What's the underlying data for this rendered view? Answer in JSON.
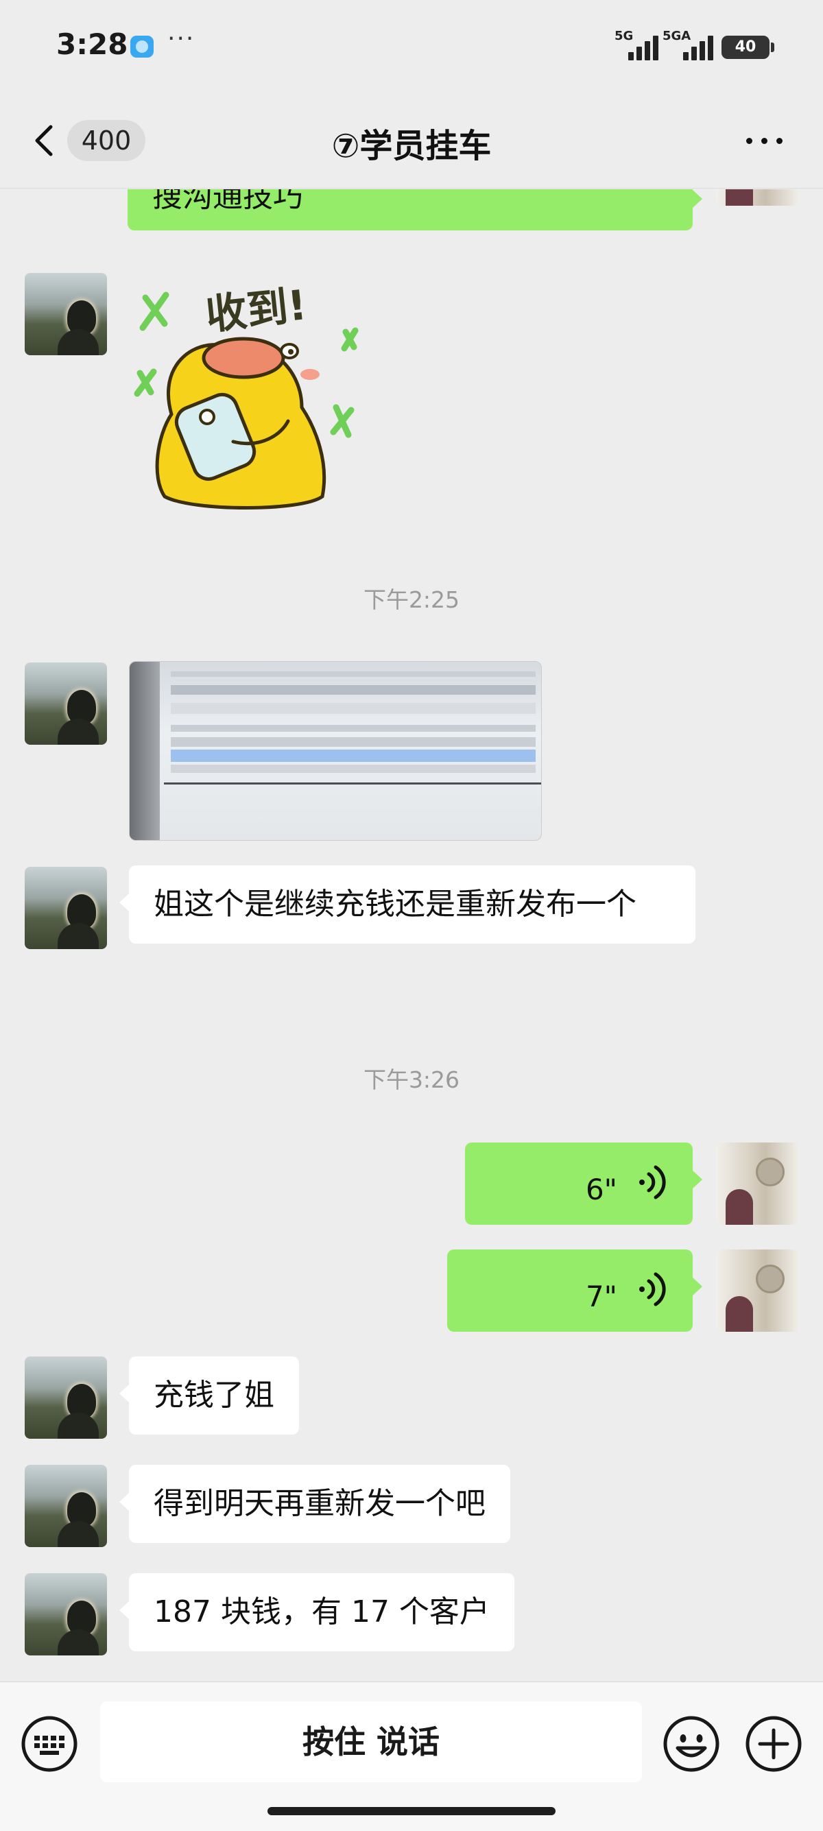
{
  "status_bar": {
    "time": "3:28",
    "more": "···",
    "network_1": "5G",
    "network_2": "5GA",
    "battery": "40"
  },
  "nav": {
    "unread_count": "400",
    "title": "⑦学员挂车"
  },
  "messages": [
    {
      "side": "right",
      "type": "text",
      "text": "搜沟通技巧"
    },
    {
      "side": "left",
      "type": "sticker",
      "sticker_text": "收到!"
    },
    {
      "type": "timestamp",
      "text": "下午2:25"
    },
    {
      "side": "left",
      "type": "image"
    },
    {
      "side": "left",
      "type": "text",
      "text": "姐这个是继续充钱还是重新发布一个"
    },
    {
      "type": "timestamp",
      "text": "下午3:26"
    },
    {
      "side": "right",
      "type": "voice",
      "duration": "6\""
    },
    {
      "side": "right",
      "type": "voice",
      "duration": "7\""
    },
    {
      "side": "left",
      "type": "text",
      "text": "充钱了姐"
    },
    {
      "side": "left",
      "type": "text",
      "text": "得到明天再重新发一个吧"
    },
    {
      "side": "left",
      "type": "text",
      "text": "187 块钱，有 17 个客户"
    }
  ],
  "input_bar": {
    "talk_label": "按住 说话"
  },
  "colors": {
    "background": "#ededed",
    "bubble_self": "#95ec69",
    "bubble_other": "#ffffff",
    "timestamp": "#9a9a9a"
  }
}
